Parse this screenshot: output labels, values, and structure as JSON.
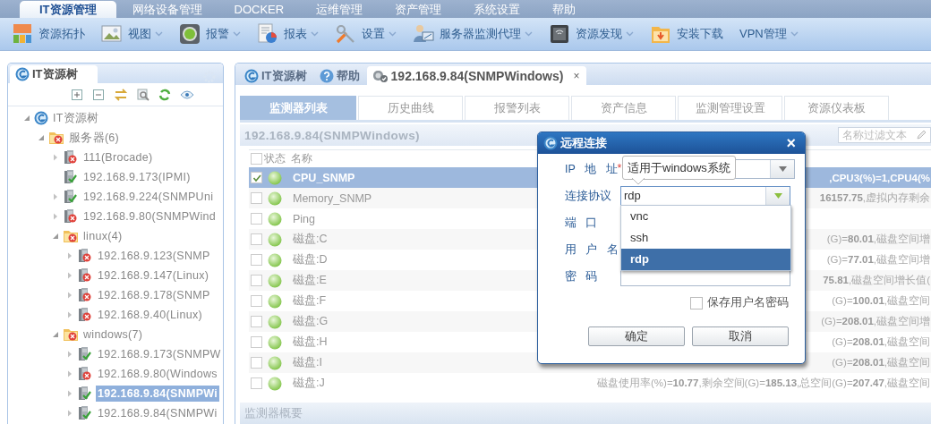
{
  "nav": {
    "tabs": [
      {
        "label": "IT资源管理",
        "selected": true
      },
      {
        "label": "网络设备管理",
        "selected": false
      },
      {
        "label": "DOCKER",
        "selected": false
      },
      {
        "label": "运维管理",
        "selected": false
      },
      {
        "label": "资产管理",
        "selected": false
      },
      {
        "label": "系统设置",
        "selected": false
      },
      {
        "label": "帮助",
        "selected": false
      }
    ]
  },
  "toolbar": {
    "items": [
      {
        "label": "资源拓扑",
        "dropdown": false
      },
      {
        "label": "视图",
        "dropdown": true
      },
      {
        "label": "报警",
        "dropdown": true
      },
      {
        "label": "报表",
        "dropdown": true
      },
      {
        "label": "设置",
        "dropdown": true
      },
      {
        "label": "服务器监测代理",
        "dropdown": true
      },
      {
        "label": "资源发现",
        "dropdown": true
      },
      {
        "label": "安装下载",
        "dropdown": false
      },
      {
        "label": "VPN管理",
        "dropdown": true
      }
    ]
  },
  "tree_panel": {
    "tab": "IT资源树",
    "tree": [
      {
        "label": "IT资源树",
        "kind": "root",
        "expanded": true,
        "selected": false,
        "children": [
          {
            "label": "服务器(6)",
            "kind": "group",
            "alert": true,
            "expanded": true,
            "selected": false,
            "children": [
              {
                "label": "111(Brocade)",
                "kind": "server",
                "alert": true,
                "expanded": false,
                "selected": false
              },
              {
                "label": "192.168.9.173(IPMI)",
                "kind": "server",
                "alert": false,
                "selected": false
              },
              {
                "label": "192.168.9.224(SNMPUni",
                "kind": "server",
                "alert": false,
                "expanded": false,
                "selected": false
              },
              {
                "label": "192.168.9.80(SNMPWind",
                "kind": "server",
                "alert": true,
                "expanded": false,
                "selected": false
              },
              {
                "label": "linux(4)",
                "kind": "group",
                "alert": true,
                "expanded": true,
                "selected": false,
                "children": [
                  {
                    "label": "192.168.9.123(SNMP",
                    "kind": "server",
                    "alert": true,
                    "expanded": false,
                    "selected": false
                  },
                  {
                    "label": "192.168.9.147(Linux)",
                    "kind": "server",
                    "alert": true,
                    "expanded": false,
                    "selected": false
                  },
                  {
                    "label": "192.168.9.178(SNMP",
                    "kind": "server",
                    "alert": true,
                    "expanded": false,
                    "selected": false
                  },
                  {
                    "label": "192.168.9.40(Linux)",
                    "kind": "server",
                    "alert": true,
                    "expanded": false,
                    "selected": false
                  }
                ]
              },
              {
                "label": "windows(7)",
                "kind": "group",
                "alert": true,
                "expanded": true,
                "selected": false,
                "children": [
                  {
                    "label": "192.168.9.173(SNMPW",
                    "kind": "server",
                    "alert": false,
                    "expanded": false,
                    "selected": false
                  },
                  {
                    "label": "192.168.9.80(Windows",
                    "kind": "server",
                    "alert": true,
                    "expanded": false,
                    "selected": false
                  },
                  {
                    "label": "192.168.9.84(SNMPWi",
                    "kind": "server",
                    "alert": false,
                    "expanded": false,
                    "selected": true
                  },
                  {
                    "label": "192.168.9.84(SNMPWi",
                    "kind": "server",
                    "alert": false,
                    "expanded": false,
                    "selected": false
                  }
                ]
              }
            ]
          }
        ]
      }
    ]
  },
  "tabs": [
    {
      "label": "IT资源树",
      "kind": "tree",
      "selected": false
    },
    {
      "label": "帮助",
      "kind": "help",
      "selected": false
    },
    {
      "label": "192.168.9.84(SNMPWindows)",
      "kind": "resource",
      "selected": true,
      "close": "×"
    }
  ],
  "subtabs": [
    {
      "label": "监测器列表",
      "selected": true
    },
    {
      "label": "历史曲线",
      "selected": false
    },
    {
      "label": "报警列表",
      "selected": false
    },
    {
      "label": "资产信息",
      "selected": false
    },
    {
      "label": "监测管理设置",
      "selected": false
    },
    {
      "label": "资源仪表板",
      "selected": false
    }
  ],
  "resource_title": "192.168.9.84(SNMPWindows)",
  "filter": {
    "placeholder": "名称过滤文本"
  },
  "table": {
    "all_checked": false,
    "columns": [
      "状态",
      "名称"
    ],
    "rows": [
      {
        "checked": true,
        "selected": true,
        "alert": false,
        "name": "CPU_SNMP",
        "detail": ",CPU3(%)=1,CPU4(%"
      },
      {
        "checked": false,
        "selected": false,
        "alert": false,
        "name": "Memory_SNMP",
        "detail": "**16157.75**,虚拟内存剩余"
      },
      {
        "checked": false,
        "selected": false,
        "alert": false,
        "name": "Ping"
      },
      {
        "checked": false,
        "selected": false,
        "alert": false,
        "name": "磁盘:C",
        "detail": "(G)=**80.01**,磁盘空间增"
      },
      {
        "checked": false,
        "selected": false,
        "alert": false,
        "name": "磁盘:D",
        "detail": "(G)=**77.01**,磁盘空间增"
      },
      {
        "checked": false,
        "selected": false,
        "alert": false,
        "name": "磁盘:E",
        "detail": "**75.81**,磁盘空间增长值("
      },
      {
        "checked": false,
        "selected": false,
        "alert": false,
        "name": "磁盘:F",
        "detail": "(G)=**100.01**,磁盘空间"
      },
      {
        "checked": false,
        "selected": false,
        "alert": false,
        "name": "磁盘:G",
        "detail": "(G)=**208.01**,磁盘空间增"
      },
      {
        "checked": false,
        "selected": false,
        "alert": false,
        "name": "磁盘:H",
        "detail": "(G)=**208.01**,磁盘空间"
      },
      {
        "checked": false,
        "selected": false,
        "alert": false,
        "name": "磁盘:I",
        "detail": "(G)=**208.01**,磁盘空间"
      },
      {
        "checked": false,
        "selected": false,
        "alert": false,
        "name": "磁盘:J",
        "detail": "磁盘使用率(%)=**10.77**,剩余空间(G)=**185.13**,总空间(G)=**207.47**,磁盘空间"
      }
    ]
  },
  "summary_bar": "监测器概要",
  "dialog": {
    "title": "远程连接",
    "close": "×",
    "fields": [
      {
        "label": "IP 地 址",
        "mark": "*",
        "kind": "combo"
      },
      {
        "label": "连接协议",
        "kind": "combo",
        "value": "rdp",
        "open": true
      },
      {
        "label": "端 口",
        "kind": "hidden"
      },
      {
        "label": "用 户 名",
        "kind": "hidden"
      },
      {
        "label": "密 码",
        "kind": "text"
      }
    ],
    "tooltip": "适用于windows系统",
    "options": [
      {
        "label": "vnc",
        "selected": false
      },
      {
        "label": "ssh",
        "selected": false
      },
      {
        "label": "rdp",
        "selected": true
      }
    ],
    "remember": {
      "label": "保存用户名密码",
      "checked": false
    },
    "buttons": [
      "确定",
      "取消"
    ]
  }
}
